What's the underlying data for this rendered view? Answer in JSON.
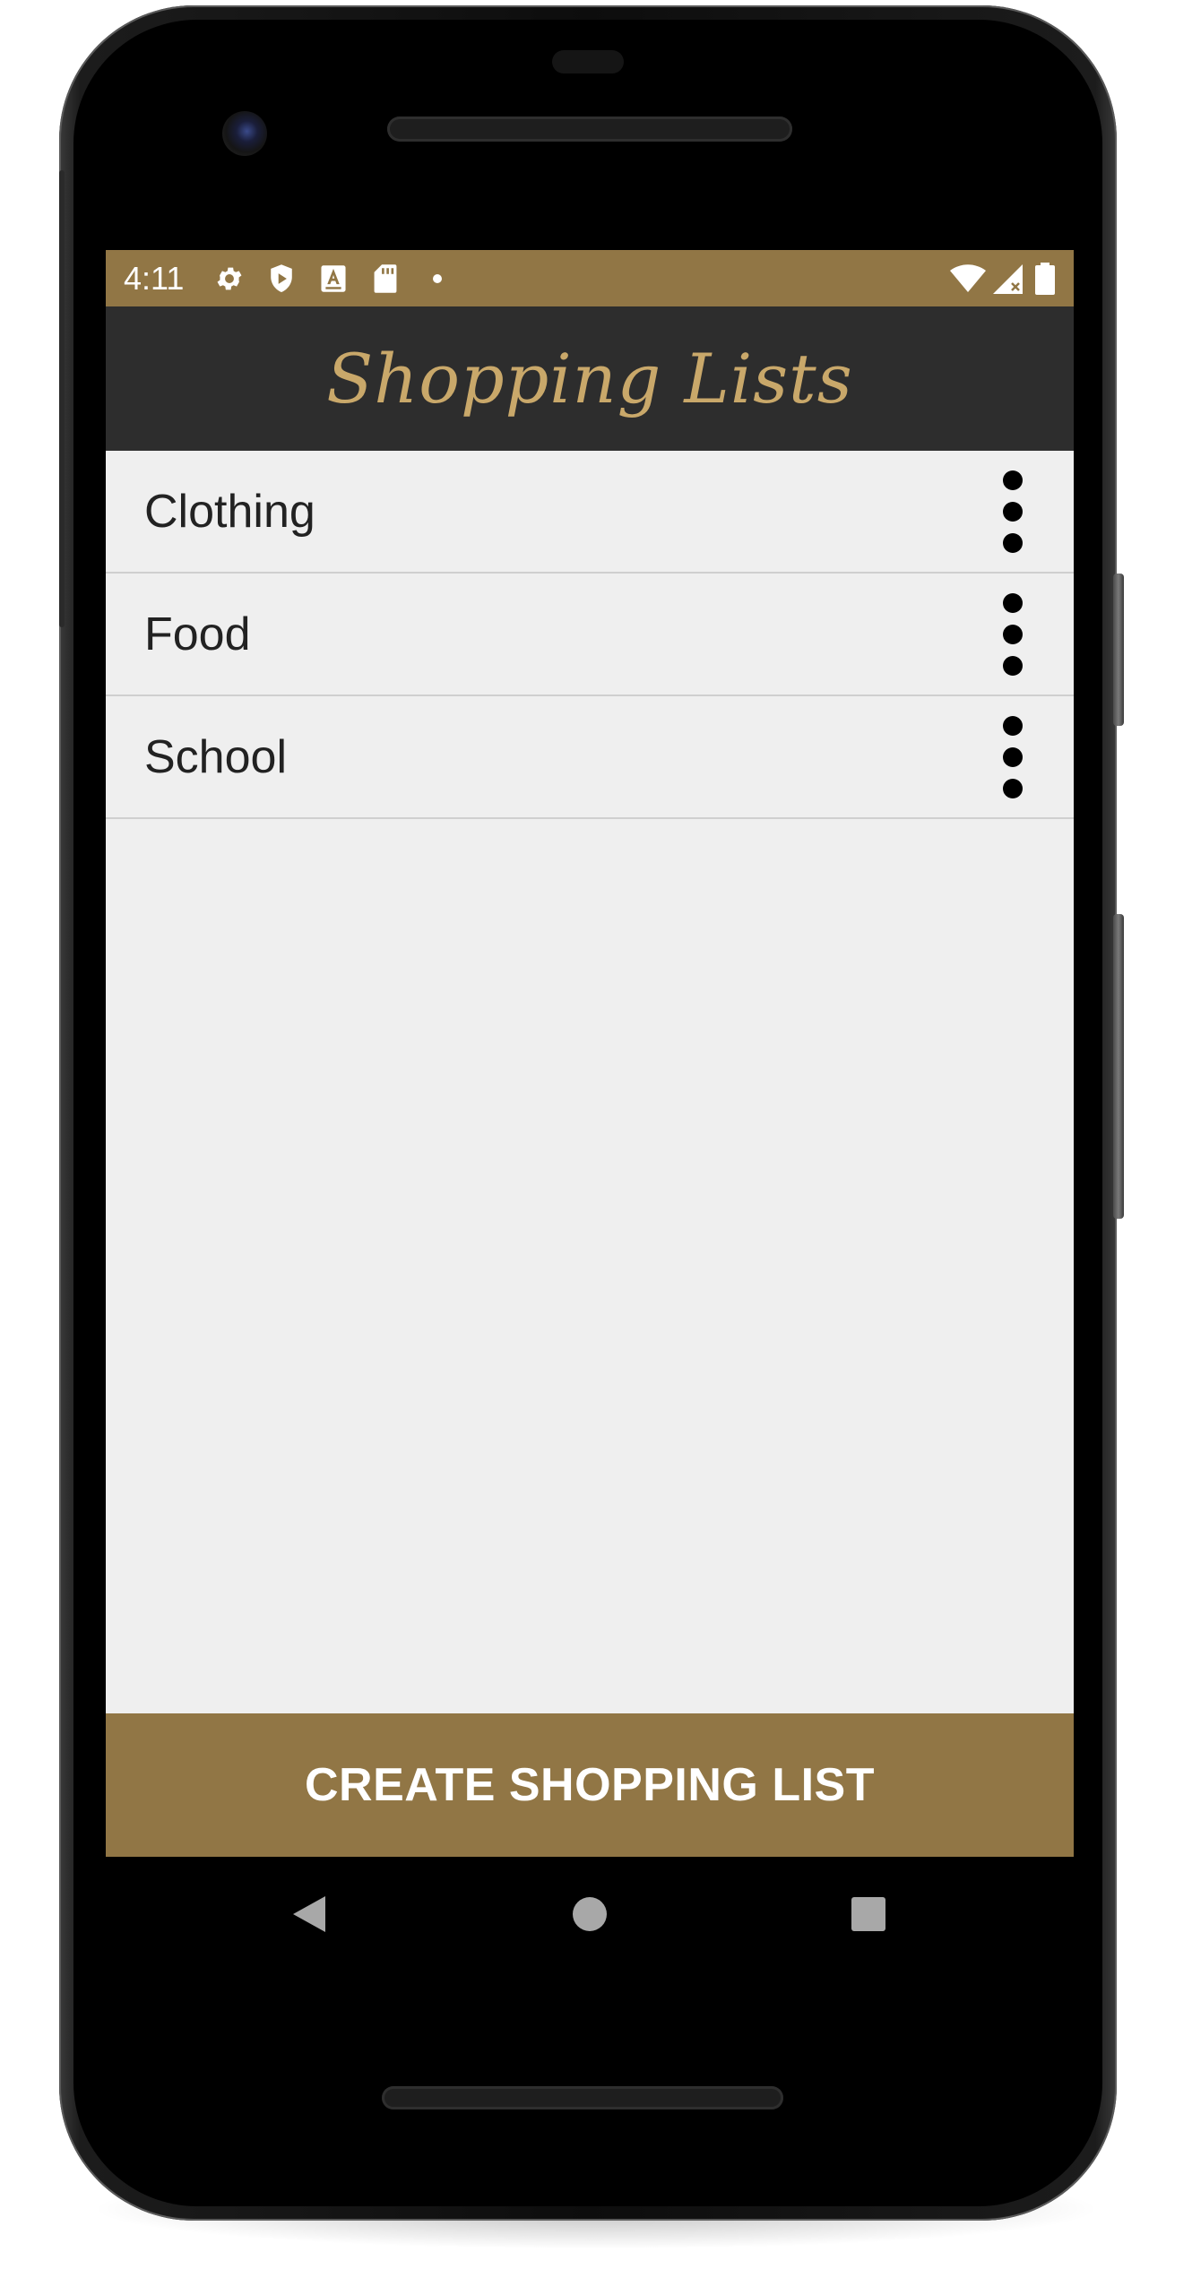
{
  "status_bar": {
    "time": "4:11",
    "left_icons": [
      "gear-icon",
      "shield-play-icon",
      "font-a-icon",
      "sd-card-icon",
      "dot-icon"
    ],
    "right_icons": [
      "wifi-icon",
      "signal-icon",
      "battery-icon"
    ]
  },
  "app_bar": {
    "title": "Shopping Lists"
  },
  "lists": [
    {
      "label": "Clothing"
    },
    {
      "label": "Food"
    },
    {
      "label": "School"
    }
  ],
  "create_button": {
    "label": "CREATE SHOPPING LIST"
  },
  "nav_bar": {
    "buttons": [
      "back-icon",
      "home-icon",
      "recents-icon"
    ]
  },
  "colors": {
    "accent": "#917645",
    "toolbar": "#2d2d2d",
    "title_text": "#c9a86a",
    "background": "#efefef"
  }
}
